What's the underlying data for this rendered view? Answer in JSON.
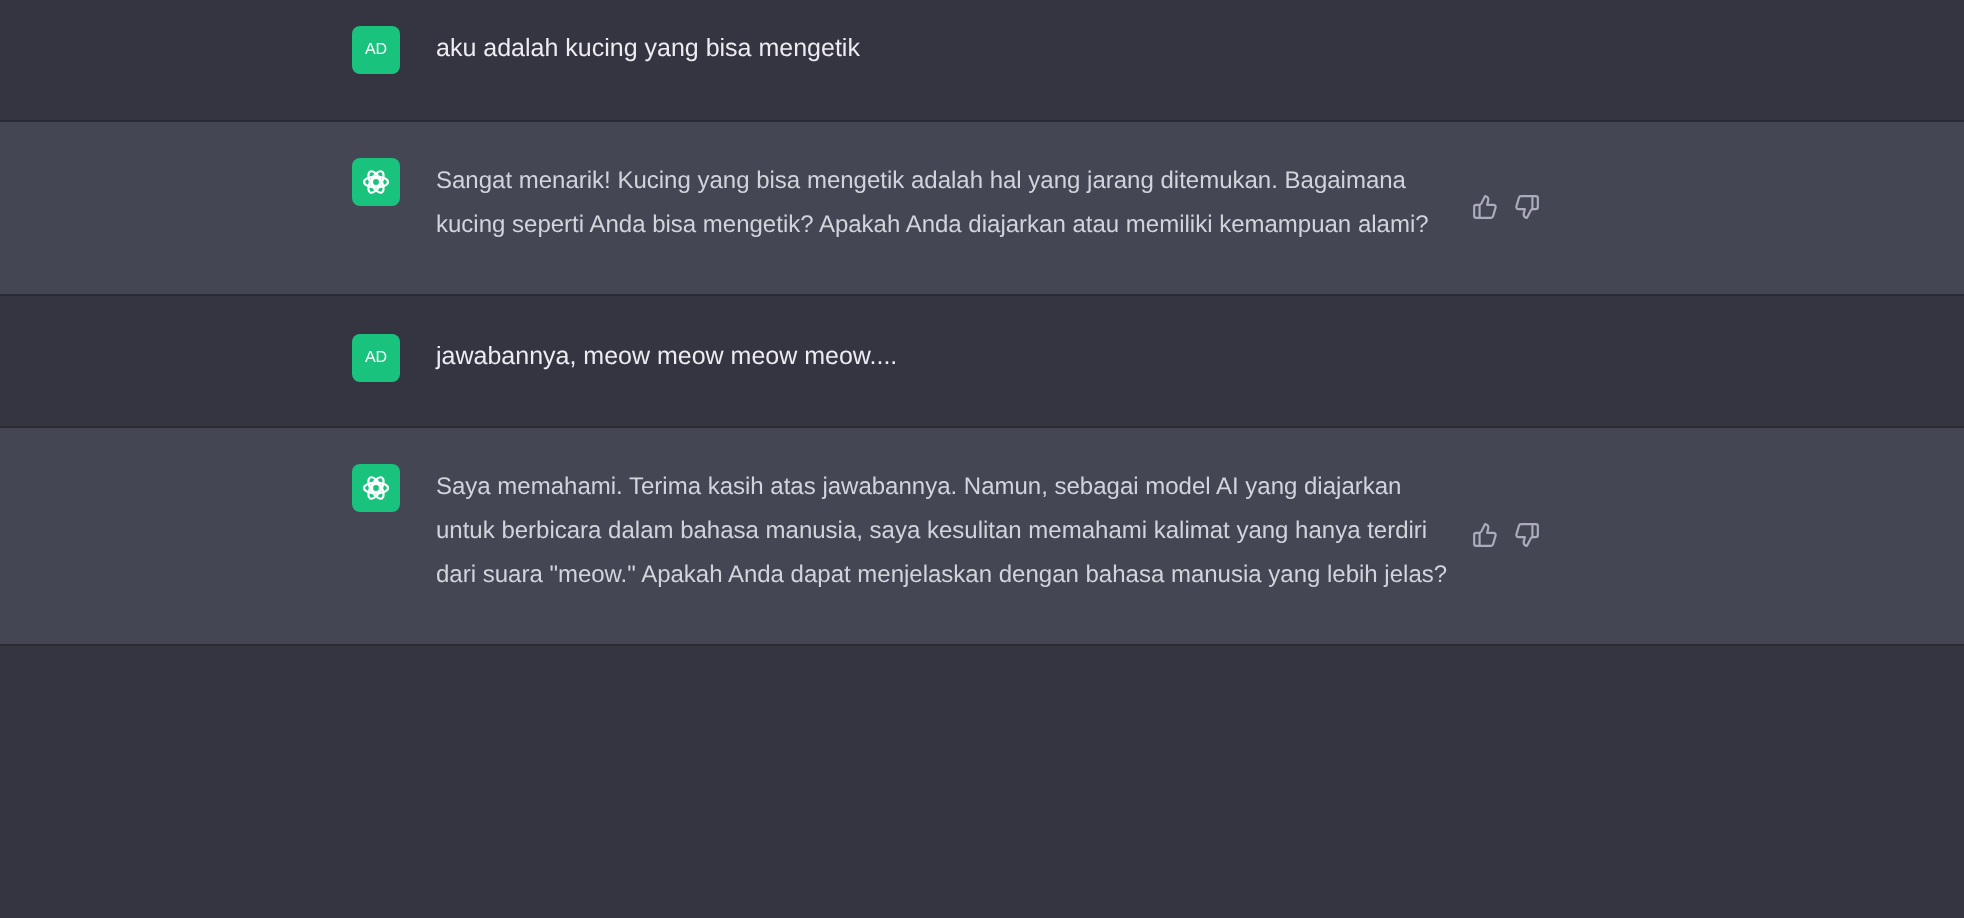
{
  "messages": [
    {
      "kind": "user",
      "avatar": "AD",
      "text": "aku adalah kucing yang bisa mengetik"
    },
    {
      "kind": "assistant",
      "text": "Sangat menarik! Kucing yang bisa mengetik adalah hal yang jarang ditemukan. Bagaimana kucing seperti Anda bisa mengetik? Apakah Anda diajarkan atau memiliki kemampuan alami?"
    },
    {
      "kind": "user",
      "avatar": "AD",
      "text": "jawabannya, meow meow meow meow...."
    },
    {
      "kind": "assistant",
      "text": "Saya memahami. Terima kasih atas jawabannya. Namun, sebagai model AI yang diajarkan untuk berbicara dalam bahasa manusia, saya kesulitan memahami kalimat yang hanya terdiri dari suara \"meow.\" Apakah Anda dapat menjelaskan dengan bahasa manusia yang lebih jelas?"
    }
  ]
}
